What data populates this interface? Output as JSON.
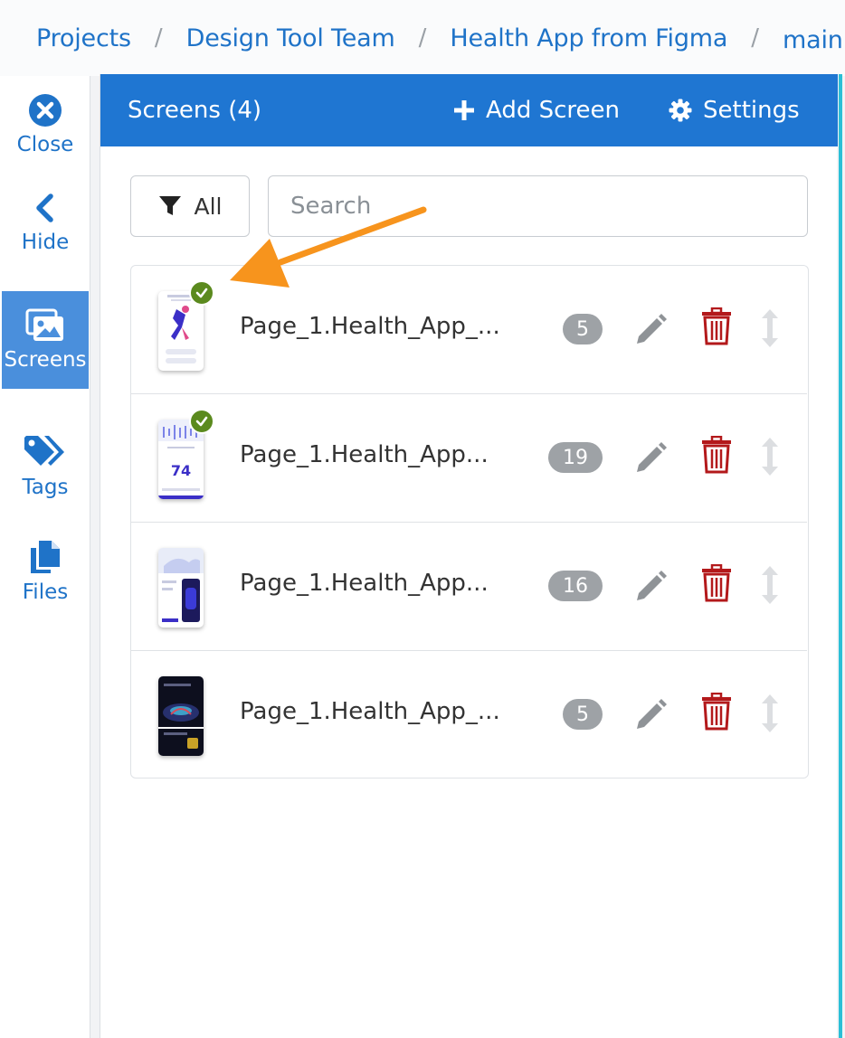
{
  "breadcrumb": [
    "Projects",
    "Design Tool Team",
    "Health App from Figma",
    "main"
  ],
  "sidenav": [
    {
      "label": "Close",
      "icon": "close-circle-icon"
    },
    {
      "label": "Hide",
      "icon": "chevron-left-icon"
    },
    {
      "label": "Screens",
      "icon": "images-icon",
      "active": true
    },
    {
      "label": "Tags",
      "icon": "tags-icon"
    },
    {
      "label": "Files",
      "icon": "files-icon"
    }
  ],
  "panel": {
    "title": "Screens (4)",
    "add_label": "Add Screen",
    "settings_label": "Settings"
  },
  "filter": {
    "label": "All"
  },
  "search": {
    "placeholder": "Search",
    "value": ""
  },
  "screens": [
    {
      "name": "Page_1.Health_App_...",
      "count": "5",
      "checked": true
    },
    {
      "name": "Page_1.Health_App...",
      "count": "19",
      "checked": true
    },
    {
      "name": "Page_1.Health_App...",
      "count": "16",
      "checked": false
    },
    {
      "name": "Page_1.Health_App_...",
      "count": "5",
      "checked": false
    }
  ],
  "colors": {
    "link": "#1f73c8",
    "header": "#1f76d2",
    "active_nav": "#4a8fdc",
    "delete": "#b3191b",
    "check": "#5b8a1e",
    "arrow": "#f7941d"
  }
}
